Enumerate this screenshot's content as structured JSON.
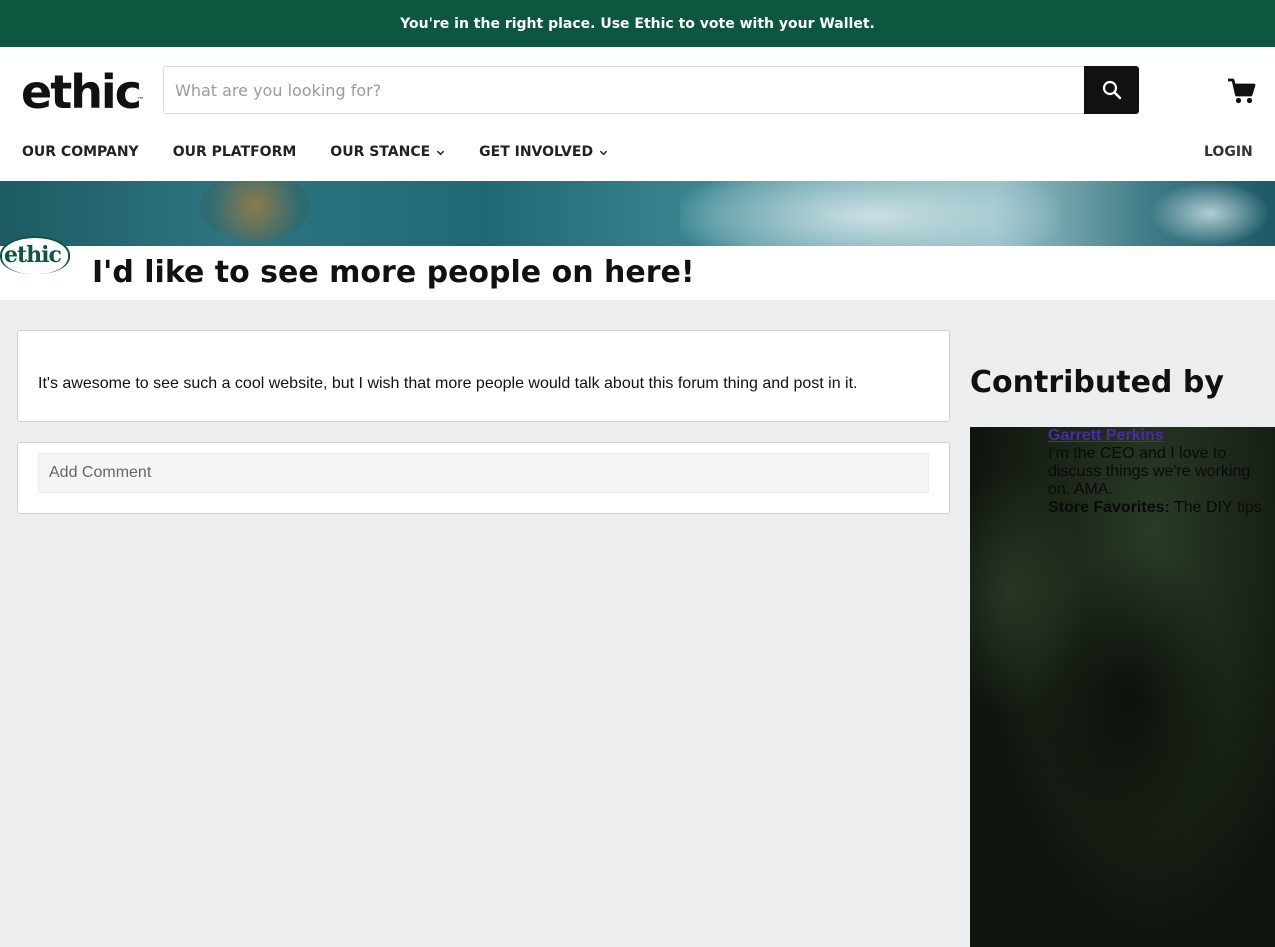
{
  "announcement": "You're in the right place. Use Ethic to vote with your Wallet.",
  "brand": {
    "logo_text": "ethic",
    "trademark": "™",
    "badge_text": "ethic",
    "color": "#0d5741"
  },
  "search": {
    "placeholder": "What are you looking for?",
    "value": ""
  },
  "icons": {
    "search": "search-icon",
    "cart": "cart-icon",
    "chevron": "chevron-down-icon"
  },
  "nav": {
    "items": [
      {
        "label": "OUR COMPANY",
        "has_dropdown": false
      },
      {
        "label": "OUR PLATFORM",
        "has_dropdown": false
      },
      {
        "label": "OUR STANCE",
        "has_dropdown": true
      },
      {
        "label": "GET INVOLVED",
        "has_dropdown": true
      }
    ],
    "login": "LOGIN"
  },
  "post": {
    "title": "I'd like to see more people on here!",
    "body": "It's awesome to see such a cool website, but I wish that more people would talk about this forum thing and post in it."
  },
  "comment": {
    "placeholder": "Add Comment"
  },
  "contributor": {
    "heading": "Contributed by",
    "name": "Garrett Perkins",
    "bio": "I'm the CEO and I love to discuss things we're working on. AMA.",
    "favorites_label": "Store Favorites:",
    "favorites_value": "The DIY tips"
  },
  "colors": {
    "announcement_bg": "#0d5741",
    "page_bg": "#edeeef",
    "link": "#4b2aa8"
  }
}
